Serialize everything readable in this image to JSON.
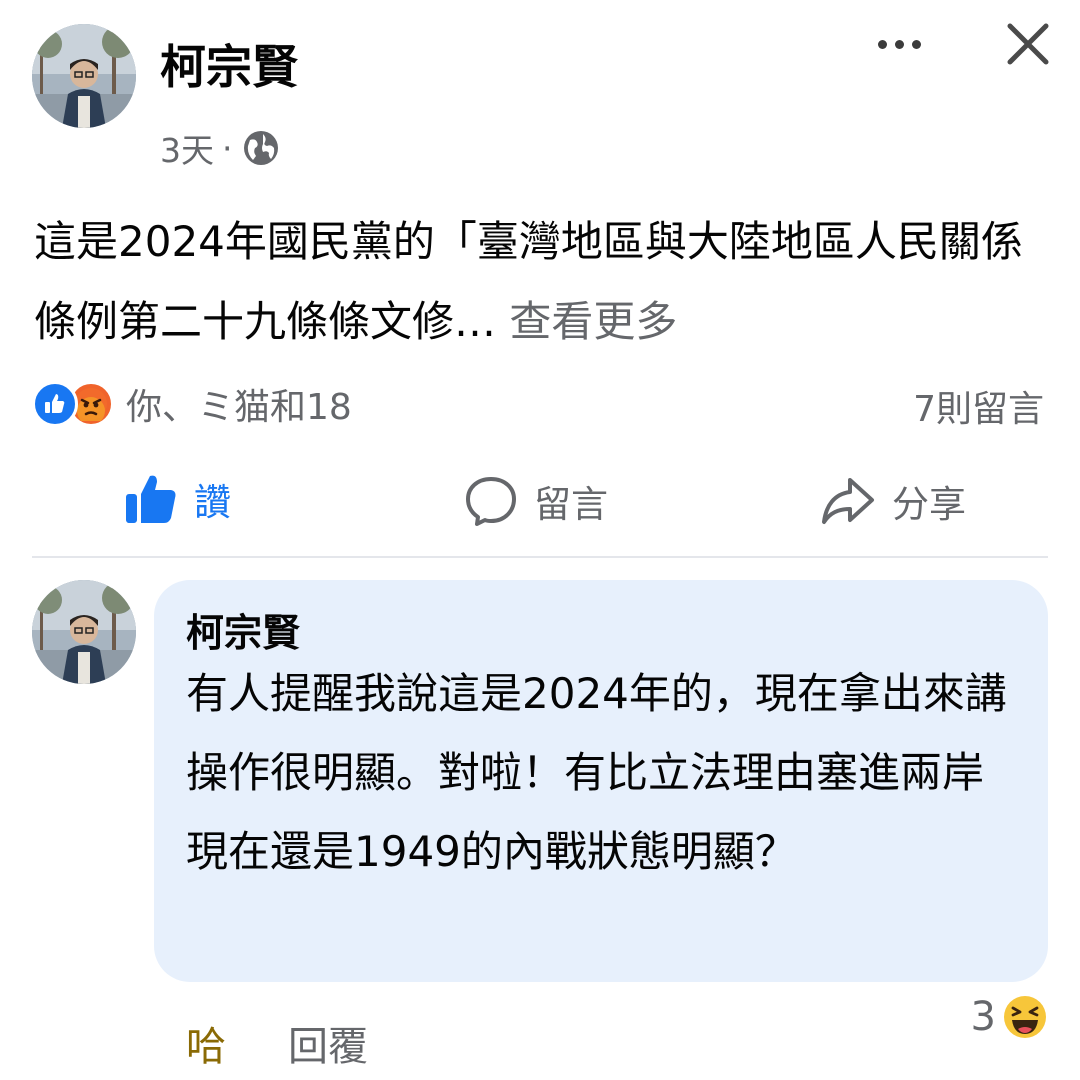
{
  "post": {
    "author": "柯宗賢",
    "time": "3天",
    "separator": "·",
    "privacy_icon": "globe-icon",
    "text": "這是2024年國民黨的「臺灣地區與大陸地區人民關係條例第二十九條條文修…",
    "see_more": "查看更多",
    "reactions": {
      "icons": [
        "like-icon",
        "angry-icon"
      ],
      "summary": "你、ミ猫和18",
      "comments_count": "7則留言"
    },
    "actions": {
      "like_label": "讚",
      "comment_label": "留言",
      "share_label": "分享"
    }
  },
  "comment": {
    "author": "柯宗賢",
    "text": "有人提醒我說這是2024年的，現在拿出來講操作很明顯。對啦！有比立法理由塞進兩岸現在還是1949的內戰狀態明顯？",
    "reaction_label": "哈",
    "reply_label": "回覆",
    "reaction_count": "3",
    "reaction_icon": "haha-icon"
  },
  "colors": {
    "accent": "#1877f2",
    "bubble": "#e7f0fc",
    "secondary_text": "#65676b",
    "haha": "#8a6a05"
  }
}
